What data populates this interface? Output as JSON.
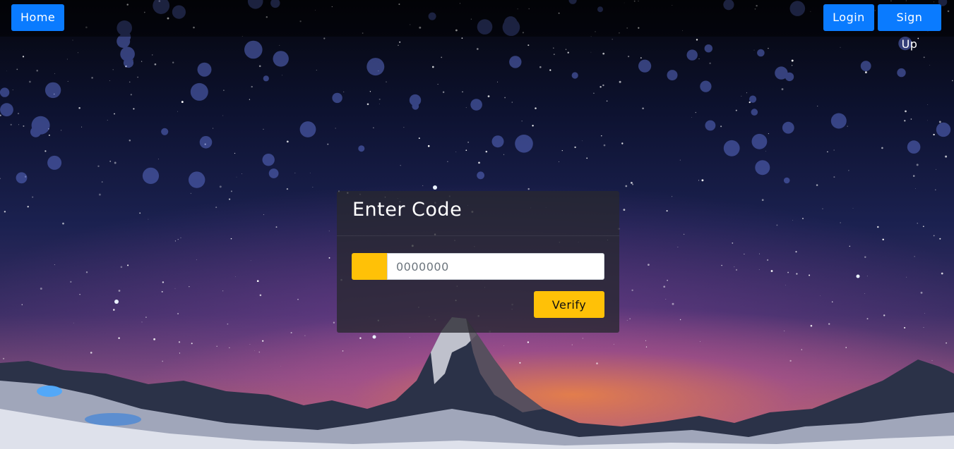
{
  "navbar": {
    "home_label": "Home",
    "login_label": "Login",
    "signup_label": "Sign Up"
  },
  "card": {
    "title": "Enter Code",
    "code_placeholder": "0000000",
    "verify_label": "Verify"
  },
  "colors": {
    "nav_button": "#0a7bff",
    "accent": "#ffc107",
    "card_background": "rgba(40,40,48,0.78)"
  },
  "background": {
    "icon": "starry-mountain-night-image"
  }
}
